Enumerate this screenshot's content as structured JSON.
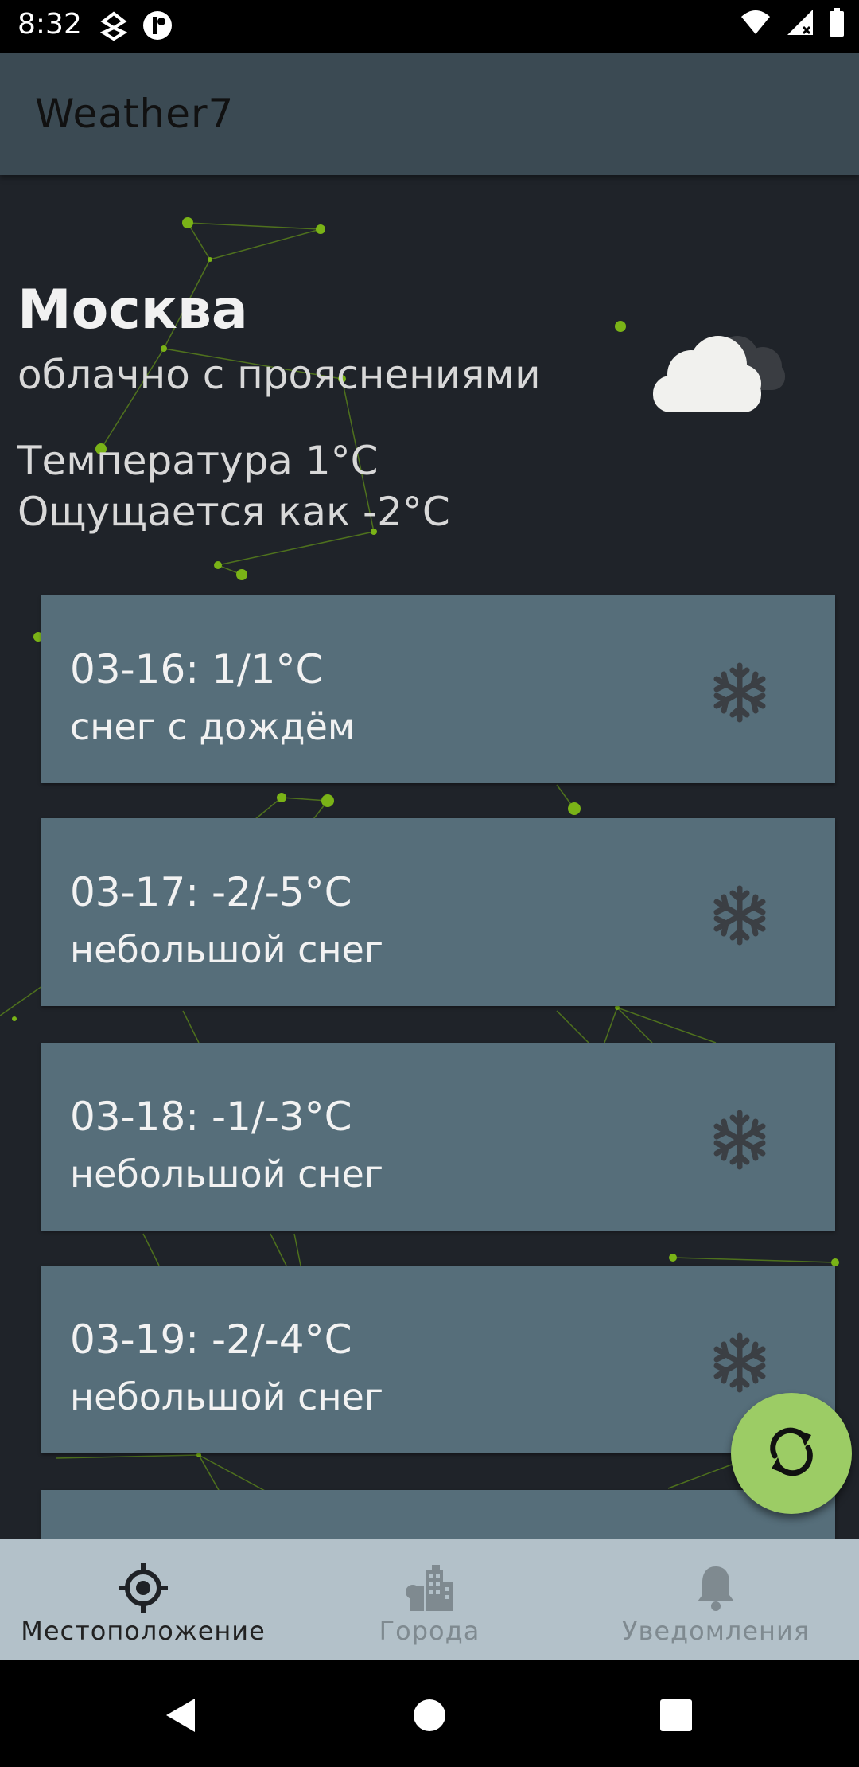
{
  "status_bar": {
    "time": "8:32"
  },
  "app": {
    "title": "Weather7"
  },
  "current": {
    "city": "Москва",
    "description": "облачно с прояснениями",
    "temperature": "Температура 1°C",
    "feels_like": "Ощущается как -2°C",
    "icon": "cloud-icon"
  },
  "forecast": [
    {
      "date_temp": "03-16: 1/1°C",
      "desc": "снег с дождём",
      "icon": "snowflake-icon"
    },
    {
      "date_temp": "03-17: -2/-5°C",
      "desc": "небольшой снег",
      "icon": "snowflake-icon"
    },
    {
      "date_temp": "03-18: -1/-3°C",
      "desc": "небольшой снег",
      "icon": "snowflake-icon"
    },
    {
      "date_temp": "03-19: -2/-4°C",
      "desc": "небольшой снег",
      "icon": "snowflake-icon"
    }
  ],
  "bottom_nav": {
    "items": [
      {
        "label": "Местоположение",
        "icon": "location-target-icon",
        "active": true
      },
      {
        "label": "Города",
        "icon": "city-icon",
        "active": false
      },
      {
        "label": "Уведомления",
        "icon": "bell-icon",
        "active": false
      }
    ]
  },
  "colors": {
    "app_bar": "#3b4a53",
    "background": "#1f2329",
    "card": "#566e7a",
    "fab": "#9ccc65",
    "bottom_nav": "#b3c1c9",
    "network_accent": "#7ab317"
  }
}
